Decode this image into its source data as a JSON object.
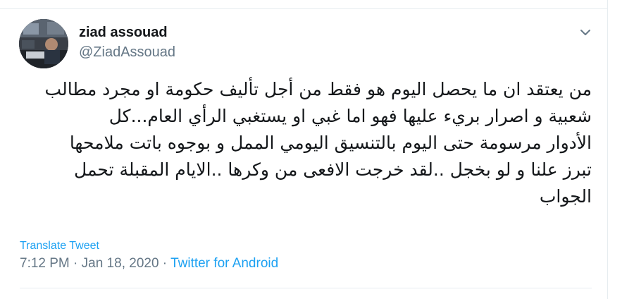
{
  "tweet": {
    "author": {
      "name": "ziad assouad",
      "handle": "@ZiadAssouad"
    },
    "text_lines": [
      "من يعتقد ان ما يحصل اليوم هو فقط من أجل تأليف حكومة او مجرد مطالب",
      "شعبية و اصرار بريء  عليها فهو اما غبي او يستغبي الرأي العام...كل",
      "الأدوار  مرسومة حتى اليوم بالتنسيق اليومي الممل و بوجوه باتت ملامحها",
      "تبرز علنا و لو بخجل ..لقد خرجت الافعى من وكرها ..الايام المقبلة تحمل",
      "الجواب"
    ],
    "translate_label": "Translate Tweet",
    "timestamp": "7:12 PM · Jan 18, 2020",
    "separator": " · ",
    "source": "Twitter for Android"
  },
  "icons": {
    "menu": "chevron-down-icon",
    "avatar": "profile-photo"
  },
  "colors": {
    "link": "#1da1f2",
    "secondary": "#657786",
    "text": "#14171a",
    "border": "#e6ecf0"
  }
}
